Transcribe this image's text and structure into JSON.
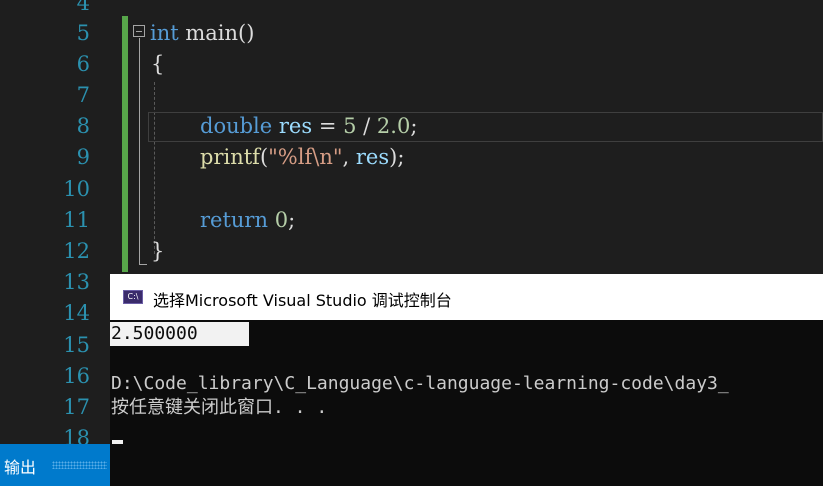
{
  "editor": {
    "line_numbers": [
      "4",
      "5",
      "6",
      "7",
      "8",
      "9",
      "10",
      "11",
      "12",
      "13",
      "14",
      "15",
      "16",
      "17",
      "18"
    ],
    "code": {
      "l5_kw": "int",
      "l5_rest": " main()",
      "l6": "{",
      "l8_kw": "double",
      "l8_var": "res",
      "l8_op": " = ",
      "l8_n1": "5",
      "l8_div": " / ",
      "l8_n2": "2.0",
      "l8_end": ";",
      "l9_fn": "printf",
      "l9_open": "(",
      "l9_str": "\"%lf\\n\"",
      "l9_comma": ", ",
      "l9_var": "res",
      "l9_end": ");",
      "l11_kw": "return",
      "l11_n": "0",
      "l11_end": ";",
      "l12": "}"
    }
  },
  "output_panel": {
    "tab_label": "输出"
  },
  "console": {
    "title": "选择Microsoft Visual Studio 调试控制台",
    "icon_text": "C:\\",
    "output_selected": "2.500000",
    "path_line": "D:\\Code_library\\C_Language\\c-language-learning-code\\day3_",
    "prompt_line": "按任意键关闭此窗口. . ."
  },
  "colors": {
    "background": "#1e1e1e",
    "line_number": "#2b91af",
    "keyword": "#569cd6",
    "number": "#b5cea8",
    "string": "#d69d85",
    "change_bar": "#57a64a",
    "output_tab": "#007acc",
    "console_bg": "#0c0c0c"
  }
}
